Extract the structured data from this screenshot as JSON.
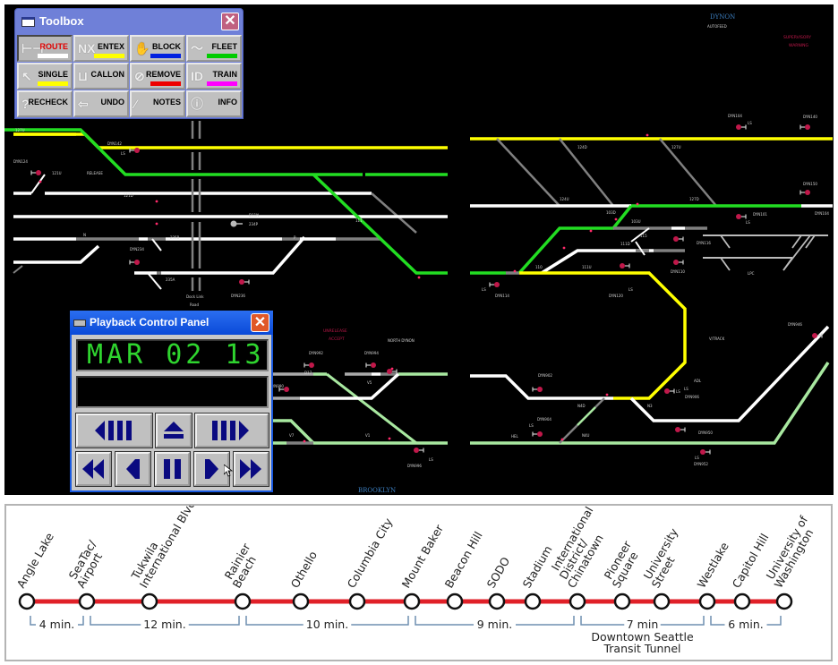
{
  "track_display": {
    "region_labels": {
      "dynon": "DYNON",
      "autofeed": "AUTOFEED",
      "supervisory": "SUPERVISORY",
      "warning": "WARNING",
      "brooklyn": "BROOKLYN",
      "north_dynon": "NORTH DYNON",
      "unrelease": "UNRELEASE",
      "accept": "ACCEPT",
      "release": "RELEASE",
      "vtrack": "V/TRACK",
      "lpc": "LPC",
      "adl": "ADL",
      "hel": "HEL",
      "dock_link": "Dock Link",
      "road": "Road"
    },
    "track_ids": [
      "127U",
      "121U",
      "121D",
      "N",
      "235B",
      "235A",
      "234P",
      "D11N",
      "111",
      "P",
      "124D",
      "127U",
      "124U",
      "127D",
      "103D",
      "103U",
      "110",
      "111U",
      "111D",
      "115",
      "D17",
      "V5",
      "V1",
      "V7",
      "N4D",
      "N4U",
      "N3"
    ],
    "signal_ids": [
      "DYN142",
      "DYN124",
      "DYN234",
      "DYN236",
      "DYN992",
      "DYN994",
      "DYN990",
      "DYN996",
      "DYN104",
      "DYN140",
      "DYN150",
      "DYN101",
      "DYN104",
      "DYN116",
      "DYN110",
      "DYN114",
      "DYN120",
      "DYN902",
      "DYN904",
      "DYN906",
      "DYN950",
      "DYN952",
      "DYN946"
    ],
    "signal_aspect_label": "LS",
    "colors": {
      "route_set": "#ffff00",
      "occupied": "#22dd22",
      "clear_green": "#a8e8a0",
      "idle": "#ffffff",
      "gray": "#808080",
      "signal": "#c0184a"
    }
  },
  "toolbox": {
    "title": "Toolbox",
    "close_label": "✕",
    "buttons": [
      {
        "label": "ROUTE",
        "icon": "route-icon",
        "glyph": "⊢⊣",
        "bar_color": "#ffffff",
        "text_color": "#e00000",
        "pressed": true
      },
      {
        "label": "ENTEX",
        "icon": "entry-exit-icon",
        "glyph": "NX",
        "bar_color": "#ffff00",
        "text_color": "#000000"
      },
      {
        "label": "BLOCK",
        "icon": "hand-icon",
        "glyph": "✋",
        "bar_color": "#0020e0",
        "text_color": "#000000"
      },
      {
        "label": "FLEET",
        "icon": "fleet-icon",
        "glyph": "〜",
        "bar_color": "#00cc00",
        "text_color": "#000000"
      },
      {
        "label": "SINGLE",
        "icon": "pointer-icon",
        "glyph": "↖",
        "bar_color": "#ffff00",
        "text_color": "#000000"
      },
      {
        "label": "CALLON",
        "icon": "callon-icon",
        "glyph": "⊔",
        "bar_color": "",
        "text_color": "#000000"
      },
      {
        "label": "REMOVE",
        "icon": "remove-icon",
        "glyph": "⊘",
        "bar_color": "#ee0000",
        "text_color": "#000000"
      },
      {
        "label": "TRAIN",
        "icon": "train-id-icon",
        "glyph": "ID",
        "bar_color": "#ff00ff",
        "text_color": "#000000"
      },
      {
        "label": "RECHECK",
        "icon": "question-icon",
        "glyph": "?",
        "bar_color": "",
        "text_color": "#000000"
      },
      {
        "label": "UNDO",
        "icon": "undo-arrow-icon",
        "glyph": "⇦",
        "bar_color": "",
        "text_color": "#000000"
      },
      {
        "label": "NOTES",
        "icon": "pen-icon",
        "glyph": "⁄",
        "bar_color": "",
        "text_color": "#000000"
      },
      {
        "label": "INFO",
        "icon": "info-icon",
        "glyph": "ⓘ",
        "bar_color": "",
        "text_color": "#000000"
      }
    ]
  },
  "playback": {
    "title": "Playback Control Panel",
    "close_label": "✕",
    "date_display": "MAR 02 13",
    "secondary_display": "",
    "buttons": [
      "step-back-long",
      "eject",
      "step-forward-long",
      "rewind",
      "step-back",
      "pause",
      "play",
      "fast-forward"
    ]
  },
  "route_map": {
    "line_color": "#e02028",
    "bracket_color": "#6f8fb0",
    "stations": [
      {
        "name": [
          "Angle Lake"
        ]
      },
      {
        "name": [
          "SeaTac/",
          "Airport"
        ]
      },
      {
        "name": [
          "Tukwila",
          "International Blvd"
        ]
      },
      {
        "name": [
          "Rainier",
          "Beach"
        ]
      },
      {
        "name": [
          "Othello"
        ]
      },
      {
        "name": [
          "Columbia City"
        ]
      },
      {
        "name": [
          "Mount Baker"
        ]
      },
      {
        "name": [
          "Beacon Hill"
        ]
      },
      {
        "name": [
          "SODO"
        ]
      },
      {
        "name": [
          "Stadium"
        ]
      },
      {
        "name": [
          "International",
          "District/",
          "Chinatown"
        ]
      },
      {
        "name": [
          "Pioneer",
          "Square"
        ]
      },
      {
        "name": [
          "University",
          "Street"
        ]
      },
      {
        "name": [
          "Westlake"
        ]
      },
      {
        "name": [
          "Capitol Hill"
        ]
      },
      {
        "name": [
          "University of",
          "Washington"
        ]
      }
    ],
    "segments": [
      {
        "from": 0,
        "to": 1,
        "label": "4 min."
      },
      {
        "from": 1,
        "to": 3,
        "label": "12 min."
      },
      {
        "from": 3,
        "to": 6,
        "label": "10 min."
      },
      {
        "from": 6,
        "to": 10,
        "label": "9 min."
      },
      {
        "from": 10,
        "to": 13,
        "label": "7 min",
        "sublabel": [
          "Downtown Seattle",
          "Transit Tunnel"
        ]
      },
      {
        "from": 13,
        "to": 15,
        "label": "6 min."
      }
    ]
  }
}
